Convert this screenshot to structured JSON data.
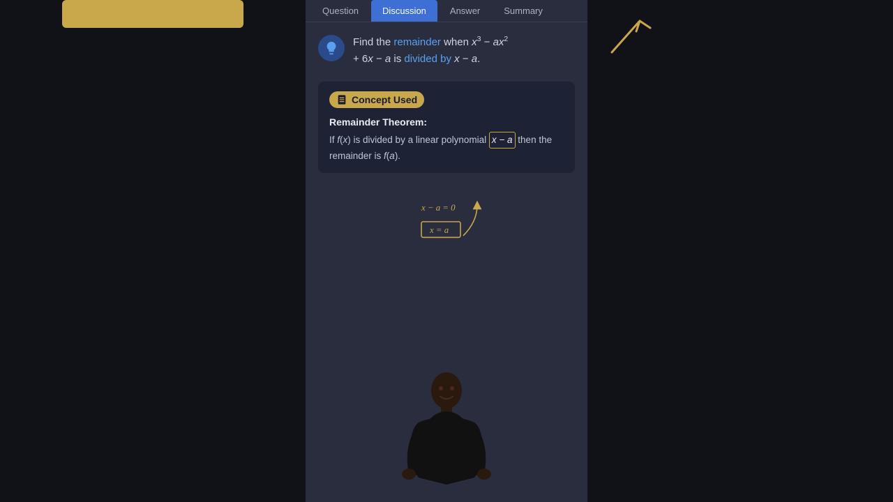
{
  "tabs": [
    {
      "id": "question",
      "label": "Question",
      "active": false
    },
    {
      "id": "discussion",
      "label": "Discussion",
      "active": true
    },
    {
      "id": "answer",
      "label": "Answer",
      "active": false
    },
    {
      "id": "summary",
      "label": "Summary",
      "active": false
    }
  ],
  "question": {
    "text_prefix": "Find the ",
    "highlight_word": "remainder",
    "text_middle": " when ",
    "math_expr": "x³ − ax²",
    "text_line2": "+ 6x − a is ",
    "highlight_divided": "divided by",
    "text_end": " x − a."
  },
  "concept": {
    "header_label": "Concept Used",
    "theorem_title": "Remainder Theorem:",
    "theorem_body_1": "If ",
    "theorem_fx": "f(x)",
    "theorem_body_2": " is divided by a linear polynomial ",
    "theorem_box": "x − a",
    "theorem_body_3": " then the remainder is ",
    "theorem_fa": "f(a)",
    "theorem_end": "."
  },
  "annotation": {
    "line1": "x - a = 0",
    "line2": "x = a"
  },
  "colors": {
    "active_tab": "#3d6fd4",
    "highlight_blue": "#5ba0f0",
    "concept_bg": "#1e2235",
    "concept_badge": "#c8a84b",
    "box_border": "#c8a84b"
  }
}
